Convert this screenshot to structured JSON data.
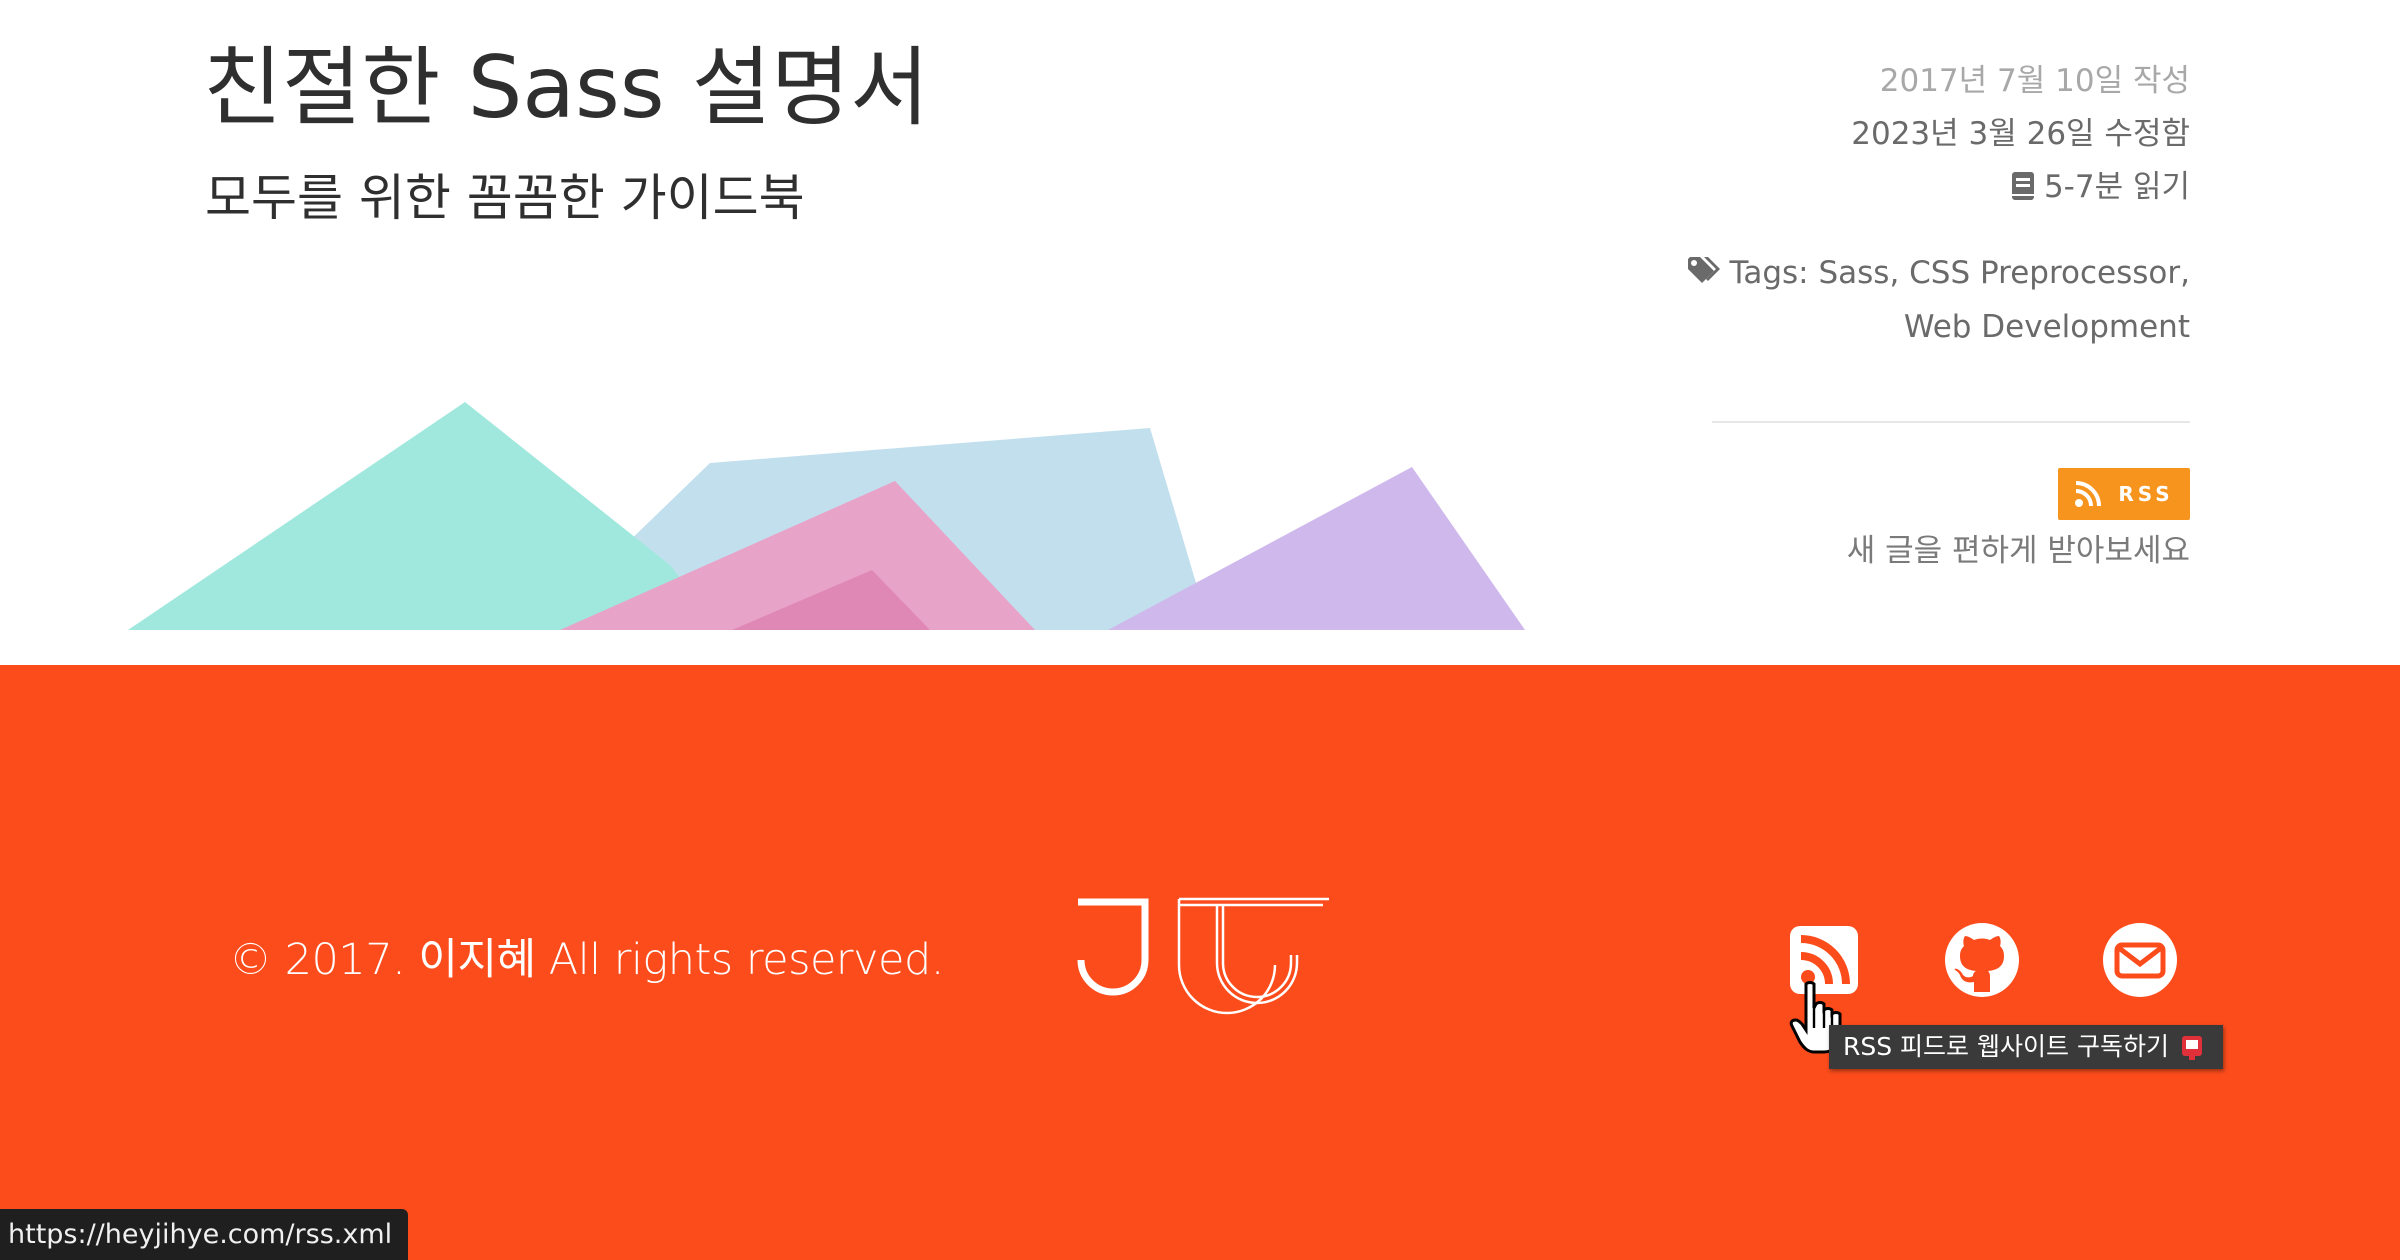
{
  "post": {
    "title": "친절한 Sass 설명서",
    "subtitle": "모두를 위한 꼼꼼한 가이드북"
  },
  "meta": {
    "created": "2017년 7월 10일 작성",
    "modified": "2023년 3월 26일 수정함",
    "reading_time": "5-7분 읽기",
    "reading_icon": "book-icon",
    "tags_icon": "tags-icon",
    "tags_label": "Tags: Sass, CSS Preprocessor, Web Development"
  },
  "subscribe": {
    "button_label": "RSS",
    "note": "새 글을 편하게 받아보세요"
  },
  "footer": {
    "copyright": "© 2017. 이지혜 All rights reserved.",
    "logo_icon": "jj-logo",
    "social": [
      {
        "name": "rss",
        "icon": "rss-icon"
      },
      {
        "name": "github",
        "icon": "github-icon"
      },
      {
        "name": "email",
        "icon": "mail-icon"
      }
    ]
  },
  "tooltip": {
    "text": "RSS 피드로 웹사이트 구독하기"
  },
  "status_bar": {
    "url": "https://heyjihye.com/rss.xml"
  },
  "colors": {
    "footer_bg": "#fc4c1c",
    "rss_orange": "#f7941e",
    "mint": "#a0e8dd",
    "sky": "#c2dfee",
    "pink": "#e8a3c8",
    "lavender": "#cfb8eb"
  }
}
